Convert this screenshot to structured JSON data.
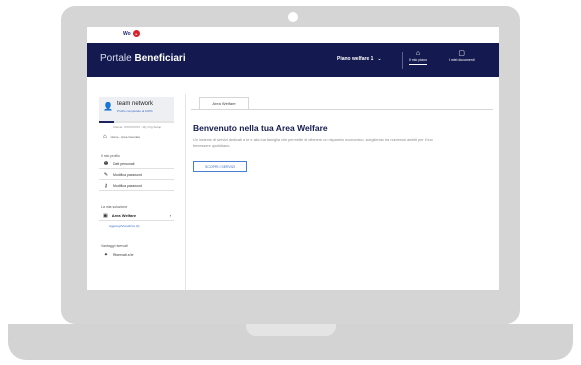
{
  "brand": {
    "logo_text": "Wo",
    "logo_mark": "a"
  },
  "header": {
    "portal_light": "Portale",
    "portal_bold": "Beneficiari",
    "plan_label": "Piano welfare 1",
    "nav_items": [
      {
        "label": "Il mio piano",
        "icon": "home-icon"
      },
      {
        "label": "I miei documenti",
        "icon": "document-icon"
      }
    ]
  },
  "sidebar": {
    "user_name": "team network",
    "user_sub": "Profilo completato al 100%",
    "profile_progress": 0.2,
    "meta_line": "Cliente: XXXXXXXX  - My Org Setup",
    "home_label": "Home - Area riservata",
    "profile_section": "Il mio profilo",
    "profile_items": [
      {
        "label": "Dati personali",
        "icon": "info-icon"
      },
      {
        "label": "Modifica password",
        "icon": "pencil-icon"
      },
      {
        "label": "Modifica password",
        "icon": "key-icon"
      }
    ],
    "wallet_section": "La mia soluzione",
    "wallet_item": "Area Welfare",
    "wallet_link": "Aggiungi/Visualizza (0)",
    "extra_section": "Vantaggi riservati",
    "extra_item": "Riservati a te"
  },
  "main": {
    "tab_label": "Area Welfare",
    "title": "Benvenuto nella tua Area Welfare",
    "description": "Un insieme di servizi dedicati a te e alla tua famiglia che permette di ottenere un risparmio economico, scegliendo tra numerosi ambiti per il tuo benessere quotidiano.",
    "cta_label": "SCOPRI I SERVIZI"
  },
  "colors": {
    "navbar": "#141a4f",
    "accent": "#3a6ec8",
    "logo_red": "#d8242c"
  }
}
